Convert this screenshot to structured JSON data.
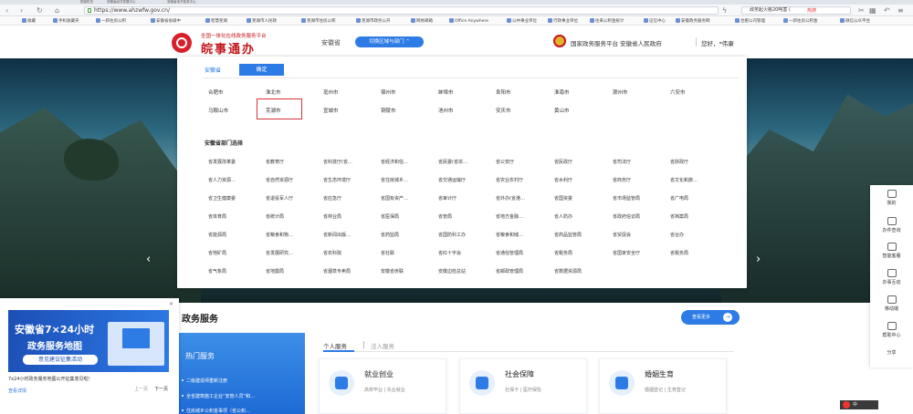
{
  "browser": {
    "tabs": [
      "院部机关",
      "安徽省经济发展中心",
      "安徽省电子政务中心"
    ],
    "url": "https://www.ahzwfw.gov.cn/",
    "search_text": "政务起火桃20吨害 (",
    "search_hot": "热搜",
    "bookmarks": [
      "收藏",
      "手机收藏夹",
      "一新往房公积",
      "安徽省省级中",
      "智慧芜湖",
      "芜湖市人民政",
      "芜湖市住房公积",
      "芜湖市政务公开",
      "网易邮箱",
      "Office Anywhere",
      "公共事业单位",
      "行政事业单位",
      "往来公积金统计",
      "征信中心",
      "安徽政务服务网",
      "合肥公司管理",
      "一新往房公积金",
      "微信公众平台"
    ]
  },
  "header": {
    "platform": "全国一体化在线政务服务平台",
    "site_name": "皖事通办",
    "province": "安徽省",
    "switch_label": "切换区域与部门",
    "national": "国家政务服务平台 安徽省人民政府",
    "user": "您好，*伟康"
  },
  "dropdown": {
    "prov_tab": "安徽省",
    "confirm": "确定",
    "cities": [
      [
        "合肥市",
        "淮北市",
        "亳州市",
        "宿州市",
        "蚌埠市",
        "阜阳市",
        "淮南市",
        "滁州市",
        "六安市"
      ],
      [
        "马鞍山市",
        "芜湖市",
        "宣城市",
        "铜陵市",
        "池州市",
        "安庆市",
        "黄山市"
      ]
    ],
    "dept_title": "安徽省部门选择",
    "depts": [
      [
        "省发展改革委",
        "省教育厅",
        "省科技厅(省…",
        "省经济和信…",
        "省民委(省宗…",
        "省公安厅",
        "省民政厅",
        "省司法厅",
        "省财政厅"
      ],
      [
        "省人力资源…",
        "省自然资源厅",
        "省生态环境厅",
        "省住房城乡…",
        "省交通运输厅",
        "省农业农村厅",
        "省水利厅",
        "省商务厅",
        "省文化和旅…"
      ],
      [
        "省卫生健康委",
        "省退役军人厅",
        "省应急厅",
        "省国有资产…",
        "省审计厅",
        "省外办(省港…",
        "省国资委",
        "省市场监管局",
        "省广电局"
      ],
      [
        "省体育局",
        "省统计局",
        "省林业局",
        "省医保局",
        "省管局",
        "省地方金融…",
        "省人防办",
        "省政府信访局",
        "省档案局"
      ],
      [
        "省能源局",
        "省粮食和物…",
        "省新闻出版…",
        "省药监局",
        "省国防科工办",
        "省粮食和储…",
        "省药品监管局",
        "省贸促会",
        "省台办"
      ],
      [
        "省地矿局",
        "省发展研究…",
        "省农科院",
        "省社联",
        "省红十字会",
        "省通信管理局",
        "省税务局",
        "省国家安全厅",
        "省税务局"
      ],
      [
        "省气象局",
        "省地震局",
        "省烟草专卖局",
        "安徽省侨联",
        "安徽边检总站",
        "省邮政管理局",
        "省数据资源局"
      ]
    ]
  },
  "right_bar": [
    "我的",
    "办件查询",
    "智能客服",
    "办事互动",
    "移动端",
    "帮助中心",
    "分享"
  ],
  "services": {
    "title": "政务服务",
    "more": "查看更多",
    "hot_title": "热门服务",
    "hot_items": [
      "二级建造师重新注册",
      "全省建筑施工企业“安管人员”和…",
      "住房城乡公积金事项（省公积…"
    ],
    "tab_person": "个人服务",
    "tab_org": "法人服务",
    "cards": [
      {
        "title": "就业创业",
        "sub": "高校毕业 | 失业就业"
      },
      {
        "title": "社会保障",
        "sub": "社保卡 | 医疗保险"
      },
      {
        "title": "婚姻生育",
        "sub": "婚姻登记 | 生育登记"
      }
    ]
  },
  "popup": {
    "close": "×",
    "line1": "安徽省7×24小时",
    "line2": "政务服务地图",
    "line3": "意见建议征集活动",
    "text": "7x24小时政务服务地图公开征集意见啦！",
    "detail": "查看详情",
    "prev": "上一页",
    "next": "下一页"
  },
  "tray": "中"
}
